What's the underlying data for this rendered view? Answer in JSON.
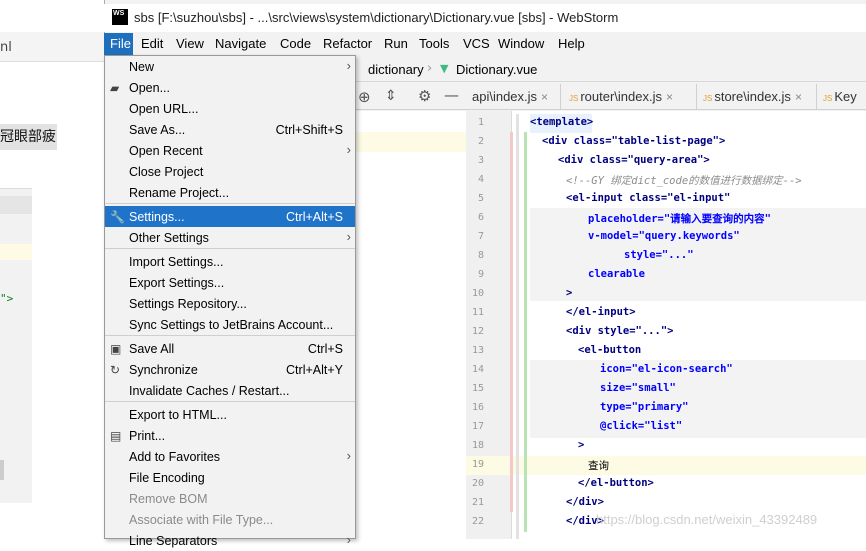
{
  "background": {
    "address_fragment": "nl",
    "cn_text": "冠眼部疲",
    "code_fragment": "\">"
  },
  "window": {
    "title": "sbs [F:\\suzhou\\sbs] - ...\\src\\views\\system\\dictionary\\Dictionary.vue [sbs] - WebStorm",
    "logo_text": "WS"
  },
  "menubar": {
    "items": [
      "File",
      "Edit",
      "View",
      "Navigate",
      "Code",
      "Refactor",
      "Run",
      "Tools",
      "VCS",
      "Window",
      "Help"
    ]
  },
  "breadcrumbs": {
    "folder": "dictionary",
    "file": "Dictionary.vue"
  },
  "tabs": [
    "api\\index.js",
    "router\\index.js",
    "store\\index.js",
    "Key"
  ],
  "file_menu": {
    "items": [
      {
        "label": "New",
        "shortcut": "",
        "submenu": true,
        "icon": "",
        "disabled": false
      },
      {
        "label": "Open...",
        "shortcut": "",
        "submenu": false,
        "icon": "folder-icon",
        "disabled": false
      },
      {
        "label": "Open URL...",
        "shortcut": "",
        "submenu": false,
        "icon": "",
        "disabled": false
      },
      {
        "label": "Save As...",
        "shortcut": "Ctrl+Shift+S",
        "submenu": false,
        "icon": "",
        "disabled": false
      },
      {
        "label": "Open Recent",
        "shortcut": "",
        "submenu": true,
        "icon": "",
        "disabled": false
      },
      {
        "label": "Close Project",
        "shortcut": "",
        "submenu": false,
        "icon": "",
        "disabled": false
      },
      {
        "label": "Rename Project...",
        "shortcut": "",
        "submenu": false,
        "icon": "",
        "disabled": false
      },
      {
        "label": "Settings...",
        "shortcut": "Ctrl+Alt+S",
        "submenu": false,
        "icon": "wrench-icon",
        "disabled": false,
        "selected": true
      },
      {
        "label": "Other Settings",
        "shortcut": "",
        "submenu": true,
        "icon": "",
        "disabled": false
      },
      {
        "label": "Import Settings...",
        "shortcut": "",
        "submenu": false,
        "icon": "",
        "disabled": false
      },
      {
        "label": "Export Settings...",
        "shortcut": "",
        "submenu": false,
        "icon": "",
        "disabled": false
      },
      {
        "label": "Settings Repository...",
        "shortcut": "",
        "submenu": false,
        "icon": "",
        "disabled": false
      },
      {
        "label": "Sync Settings to JetBrains Account...",
        "shortcut": "",
        "submenu": false,
        "icon": "",
        "disabled": false
      },
      {
        "label": "Save All",
        "shortcut": "Ctrl+S",
        "submenu": false,
        "icon": "save-icon",
        "disabled": false
      },
      {
        "label": "Synchronize",
        "shortcut": "Ctrl+Alt+Y",
        "submenu": false,
        "icon": "sync-icon",
        "disabled": false
      },
      {
        "label": "Invalidate Caches / Restart...",
        "shortcut": "",
        "submenu": false,
        "icon": "",
        "disabled": false
      },
      {
        "label": "Export to HTML...",
        "shortcut": "",
        "submenu": false,
        "icon": "",
        "disabled": false
      },
      {
        "label": "Print...",
        "shortcut": "",
        "submenu": false,
        "icon": "printer-icon",
        "disabled": false
      },
      {
        "label": "Add to Favorites",
        "shortcut": "",
        "submenu": true,
        "icon": "",
        "disabled": false
      },
      {
        "label": "File Encoding",
        "shortcut": "",
        "submenu": false,
        "icon": "",
        "disabled": false
      },
      {
        "label": "Remove BOM",
        "shortcut": "",
        "submenu": false,
        "icon": "",
        "disabled": true
      },
      {
        "label": "Associate with File Type...",
        "shortcut": "",
        "submenu": false,
        "icon": "",
        "disabled": true
      },
      {
        "label": "Line Separators",
        "shortcut": "",
        "submenu": true,
        "icon": "",
        "disabled": false
      }
    ]
  },
  "editor": {
    "line_numbers": [
      "1",
      "2",
      "3",
      "4",
      "5",
      "6",
      "7",
      "8",
      "9",
      "10",
      "11",
      "12",
      "13",
      "14",
      "15",
      "16",
      "17",
      "18",
      "19",
      "20",
      "21",
      "22"
    ],
    "lines": [
      "<template>",
      "<div class=\"table-list-page\">",
      "<div class=\"query-area\">",
      "<!--GY 绑定dict_code的数值进行数据绑定-->",
      "<el-input class=\"el-input\"",
      "placeholder=\"请输入要查询的内容\"",
      "v-model=\"query.keywords\"",
      "style=\"...\"",
      "clearable",
      ">",
      "</el-input>",
      "<div style=\"...\">",
      "<el-button",
      "icon=\"el-icon-search\"",
      "size=\"small\"",
      "type=\"primary\"",
      "@click=\"list\"",
      ">",
      "查询",
      "</el-button>",
      "</div>",
      "</div>"
    ]
  },
  "watermark": "https://blog.csdn.net/weixin_43392489"
}
